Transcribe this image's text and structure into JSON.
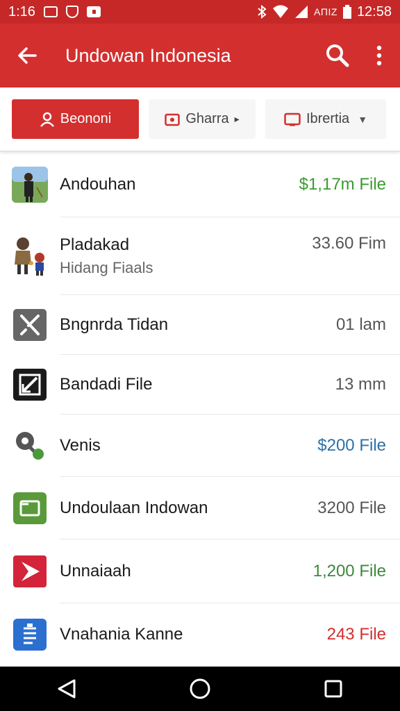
{
  "status_bar": {
    "time": "1:16",
    "right_text": "ΑΠΙΖ",
    "clock": "12:58",
    "icons": [
      "gallery-icon",
      "shield-icon",
      "notification-icon",
      "bluetooth-icon",
      "wifi-icon",
      "signal-icon",
      "battery-icon"
    ]
  },
  "app_bar": {
    "title": "Undowan Indonesia",
    "icons": [
      "back-arrow-icon",
      "search-icon",
      "more-vert-icon"
    ]
  },
  "filters": [
    {
      "label": "Beononi",
      "icon": "person-icon",
      "active": true
    },
    {
      "label": "Gharra",
      "icon": "calendar-icon",
      "active": false
    },
    {
      "label": "Ibrertia",
      "icon": "folder-icon",
      "active": false
    }
  ],
  "items": [
    {
      "name": "Andouhan",
      "sub": "",
      "size": "$1,17m File",
      "size_color": "#3b9a2f",
      "icon": "person-photo-icon"
    },
    {
      "name": "Pladakad",
      "sub": "Hidang Fiaals",
      "size": "33.60 Fim",
      "size_color": "#555555",
      "icon": "characters-icon"
    },
    {
      "name": "Bngnrda Tidan",
      "sub": "",
      "size": "01 lam",
      "size_color": "#555555",
      "icon": "tools-icon"
    },
    {
      "name": "Bandadi File",
      "sub": "",
      "size": "13 mm",
      "size_color": "#555555",
      "icon": "edit-icon"
    },
    {
      "name": "Venis",
      "sub": "",
      "size": "$200 File",
      "size_color": "#2b72a8",
      "icon": "key-icon"
    },
    {
      "name": "Undoulaan Indowan",
      "sub": "",
      "size": "3200 File",
      "size_color": "#555555",
      "icon": "folder-icon"
    },
    {
      "name": "Unnaiaah",
      "sub": "",
      "size": "1,200 File",
      "size_color": "#3b8a3a",
      "icon": "play-icon"
    },
    {
      "name": "Vnahania Kanne",
      "sub": "",
      "size": "243 File",
      "size_color": "#d32f2f",
      "icon": "document-icon"
    }
  ],
  "nav": [
    "back-triangle-icon",
    "home-circle-icon",
    "recents-square-icon"
  ],
  "colors": {
    "primary": "#d32f2f",
    "statusbar": "#c62828"
  }
}
